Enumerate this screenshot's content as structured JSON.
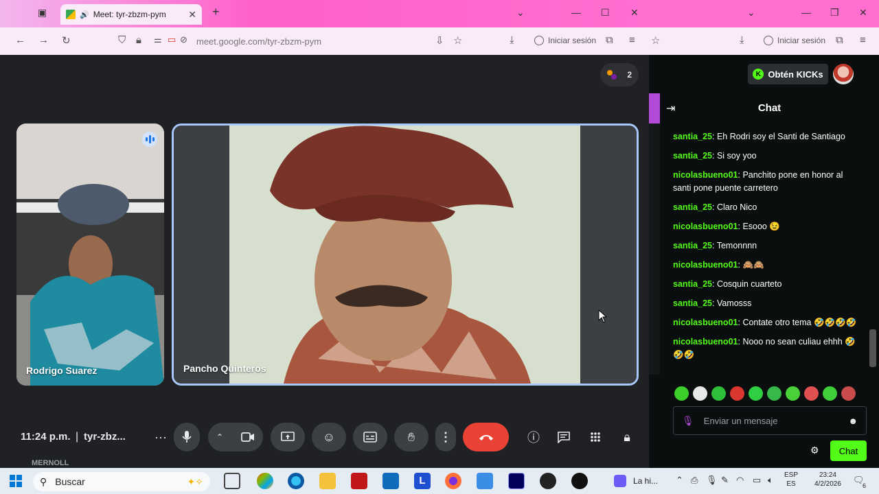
{
  "browser_left": {
    "tab_title": "Meet: tyr-zbzm-pym",
    "new_tab": "+",
    "url": "meet.google.com/tyr-zbzm-pym",
    "signin": "Iniciar sesión"
  },
  "browser_right": {
    "signin": "Iniciar sesión"
  },
  "meet": {
    "participants_count": "2",
    "tiles": [
      {
        "name": "Rodrigo Suarez",
        "speaking": true
      },
      {
        "name": "Pancho Quinteros",
        "speaking": false
      }
    ],
    "time": "11:24 p.m.",
    "separator": "|",
    "meeting_code": "tyr-zbz...",
    "peek_text": "MERNOLL",
    "controls": [
      "more-options",
      "microphone",
      "camera-options",
      "camera",
      "present",
      "reactions",
      "captions",
      "raise-hand",
      "more",
      "end-call",
      "info",
      "chat",
      "activities",
      "host-controls"
    ]
  },
  "kick": {
    "get_kicks": "Obtén KICKs",
    "chat_title": "Chat",
    "messages": [
      {
        "user": "santia_25",
        "text": "Eh Rodri soy el Santi de Santiago"
      },
      {
        "user": "santia_25",
        "text": "Si soy yoo"
      },
      {
        "user": "nicolasbueno01",
        "text": "Panchito pone en honor al santi pone puente carretero"
      },
      {
        "user": "santia_25",
        "text": "Claro Nico"
      },
      {
        "user": "nicolasbueno01",
        "text": "Esooo 😉"
      },
      {
        "user": "santia_25",
        "text": "Temonnnn"
      },
      {
        "user": "nicolasbueno01",
        "text": "🙈🙈"
      },
      {
        "user": "santia_25",
        "text": "Cosquin cuarteto"
      },
      {
        "user": "santia_25",
        "text": "Vamosss"
      },
      {
        "user": "nicolasbueno01",
        "text": "Contate otro tema 🤣🤣🤣🤣"
      },
      {
        "user": "nicolasbueno01",
        "text": "Nooo no sean culiau ehhh 🤣🤣🤣"
      }
    ],
    "input_placeholder": "Enviar un mensaje",
    "send_label": "Chat",
    "emote_colors": [
      "#3ccf2b",
      "#e8e8e8",
      "#2fbf3a",
      "#d9372f",
      "#2fcf44",
      "#36b84a",
      "#4ad13a",
      "#e05050",
      "#3fcf3a",
      "#c94b4b"
    ]
  },
  "taskbar": {
    "search": "Buscar",
    "tray_app": "La hi...",
    "lang_top": "ESP",
    "lang_bottom": "ES",
    "time": "23:24",
    "date": "4/2/2026",
    "notif_count": "6"
  },
  "colors": {
    "meet_bg": "#202124",
    "active_tile_border": "#a8c7fa",
    "end_call": "#ea4335",
    "kick_green": "#53fc18",
    "kick_purple": "#b44ad8"
  }
}
